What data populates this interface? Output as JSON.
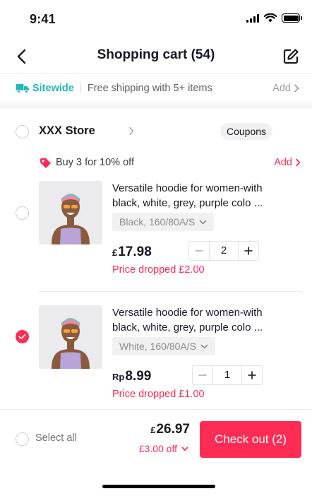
{
  "status_bar": {
    "time": "9:41"
  },
  "header": {
    "title": "Shopping cart (54)"
  },
  "shipping_banner": {
    "label": "Sitewide",
    "text": "Free shipping with 5+ items",
    "action": "Add"
  },
  "store": {
    "name": "XXX Store",
    "coupons_label": "Coupons",
    "promo_text": "Buy 3 for 10% off",
    "promo_action": "Add"
  },
  "items": [
    {
      "title": "Versatile hoodie for women-with black, white, grey, purple colo ...",
      "variant": "Black, 160/80A/S",
      "currency": "£",
      "price": "17.98",
      "quantity": "2",
      "price_drop": "Price dropped £2.00",
      "selected": false
    },
    {
      "title": "Versatile hoodie for women-with black, white, grey, purple colo ...",
      "variant": "White, 160/80A/S",
      "currency": "Rp",
      "price": "8.99",
      "quantity": "1",
      "price_drop": "Price dropped £1.00",
      "selected": true
    }
  ],
  "footer": {
    "select_all_label": "Select all",
    "total_currency": "£",
    "total_amount": "26.97",
    "discount": "£3.00 off",
    "checkout_label": "Check out (2)"
  },
  "colors": {
    "accent": "#fe2c55",
    "sitewide": "#20b8ba",
    "text": "#161823",
    "muted": "#8a8b91"
  }
}
